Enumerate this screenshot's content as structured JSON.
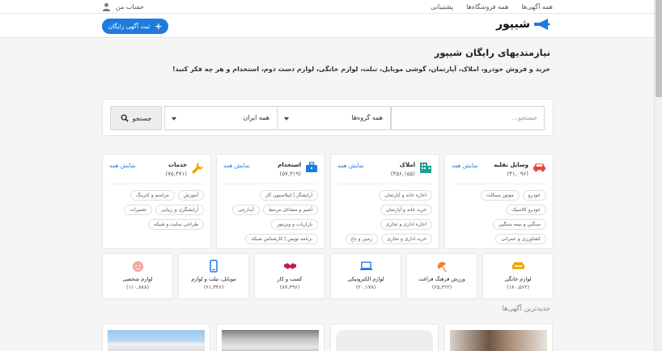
{
  "topbar": {
    "links": [
      "همه آگهی‌ها",
      "همه فروشگاه‌ها",
      "پشتیبانی"
    ],
    "account_label": "حساب من"
  },
  "header": {
    "logo_text": "شیپور",
    "post_button_label": "ثبت آگهی رایگان"
  },
  "hero": {
    "title": "نیازمندیهای رایگان شیپور",
    "subtitle": "خرید و فروش خودرو، املاک، آپارتمان، گوشی موبایل، تبلت، لوازم خانگی، لوازم دست دوم، استخدام و هر چه فکر کنید!"
  },
  "search": {
    "placeholder": "جستجو...",
    "groups_value": "همه گروه‌ها",
    "city_value": "همه ایران",
    "button_label": "جستجو"
  },
  "categories": [
    {
      "title": "وسایل نقلیه",
      "count": "(۴۱,۰۹۶)",
      "show_all": "نمایش همه",
      "icon": "car-icon",
      "color": "#e8453c",
      "tags": [
        "خودرو",
        "موتور سیکلت",
        "خودرو کلاسیک",
        "سنگین و نیمه سنگین",
        "کشاورزی و عمرانی"
      ]
    },
    {
      "title": "املاک",
      "count": "(۴۵۶,۱۵۵)",
      "show_all": "نمایش همه",
      "icon": "building-icon",
      "color": "#1f9e8f",
      "tags": [
        "اجاره خانه و آپارتمان",
        "خرید خانه و آپارتمان",
        "اجاره اداری و تجاری",
        "خرید اداری و تجاری",
        "زمین و باغ"
      ]
    },
    {
      "title": "استخدام",
      "count": "(۵۷,۳۱۹)",
      "show_all": "نمایش همه",
      "icon": "briefcase-icon",
      "color": "#1e7be0",
      "tags": [
        "آرایشگر | اپیلاسیون کار",
        "آشپز و مشاغل مرتبط",
        "آبدارچی",
        "بازاریاب و ویزیتور",
        "برنامه نویس | کارشناس شبکه"
      ]
    },
    {
      "title": "خدمات",
      "count": "(۷۵,۴۷۱)",
      "show_all": "نمایش همه",
      "icon": "wrench-icon",
      "color": "#f0a500",
      "tags": [
        "آموزش",
        "مراسم و کترینگ",
        "آرایشگری و زیبایی",
        "تعمیرات",
        "طراحی سایت و شبکه"
      ]
    }
  ],
  "mini_categories": [
    {
      "name": "لوازم خانگی",
      "count": "(۱۸۰,۵۶۲)",
      "icon": "sofa-icon",
      "color": "#f0a500"
    },
    {
      "name": "ورزش فرهنگ فراغت",
      "count": "(۲۵,۲۲۲)",
      "icon": "umbrella-icon",
      "color": "#e8843c"
    },
    {
      "name": "لوازم الکترونیکی",
      "count": "(۲۰,۱۷۸)",
      "icon": "laptop-icon",
      "color": "#1e7be0"
    },
    {
      "name": "کسب و کار",
      "count": "(۸۷,۴۹۶)",
      "icon": "handshake-icon",
      "color": "#c2185b"
    },
    {
      "name": "موبایل، تبلت و لوازم",
      "count": "(۶۱,۳۴۶)",
      "icon": "mobile-icon",
      "color": "#1e7be0"
    },
    {
      "name": "لوازم شخصی",
      "count": "(۱۱۰,۸۸۸)",
      "icon": "baby-icon",
      "color": "#e8453c"
    }
  ],
  "latest": {
    "title": "جدیدترین آگهی‌ها"
  },
  "colors": {
    "accent": "#1e7be0",
    "background": "#f5f5f5"
  }
}
